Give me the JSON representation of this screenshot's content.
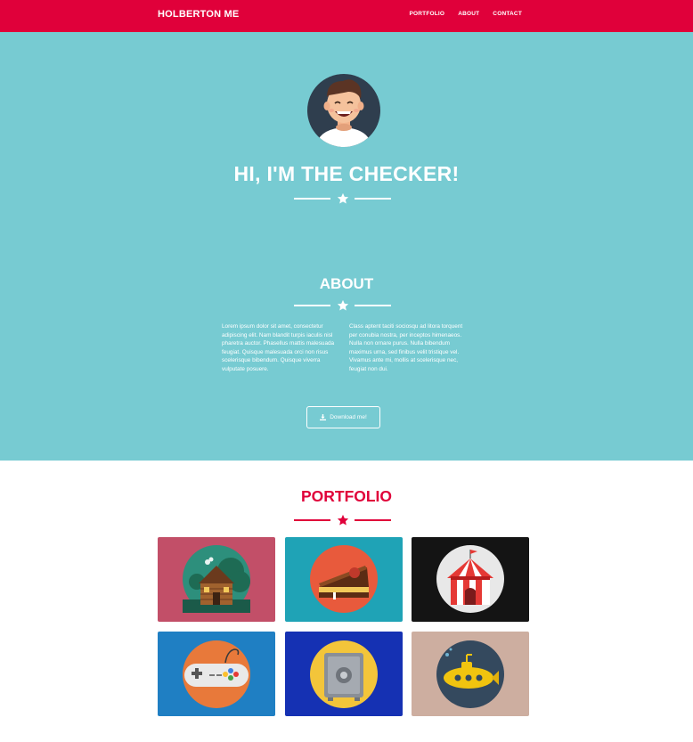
{
  "nav": {
    "brand": "HOLBERTON ME",
    "links": [
      "PORTFOLIO",
      "ABOUT",
      "CONTACT"
    ]
  },
  "hero": {
    "title": "HI, I'M THE CHECKER!"
  },
  "about": {
    "title": "ABOUT",
    "col1": "Lorem ipsum dolor sit amet, consectetur adipiscing elit. Nam blandit turpis iaculis nisl pharetra auctor. Phasellus mattis malesuada feugiat. Quisque malesuada orci non risus scelerisque bibendum. Quisque viverra vulputate posuere.",
    "col2": "Class aptent taciti sociosqu ad litora torquent per conubia nostra, per inceptos himenaeos. Nulla non ornare purus. Nulla bibendum maximus urna, sed finibus velit tristique vel. Vivamus ante mi, mollis at scelerisque nec, feugiat non dui.",
    "download_label": "Download me!"
  },
  "portfolio": {
    "title": "PORTFOLIO",
    "items": [
      {
        "name": "cabin",
        "bg": "#c24f68"
      },
      {
        "name": "cake",
        "bg": "#1fa3b6"
      },
      {
        "name": "circus",
        "bg": "#141414"
      },
      {
        "name": "game-controller",
        "bg": "#1f7fc3"
      },
      {
        "name": "safe",
        "bg": "#1531b3"
      },
      {
        "name": "submarine",
        "bg": "#cdaea0"
      }
    ]
  },
  "colors": {
    "accent": "#e0003a",
    "teal": "#77cbd2"
  }
}
